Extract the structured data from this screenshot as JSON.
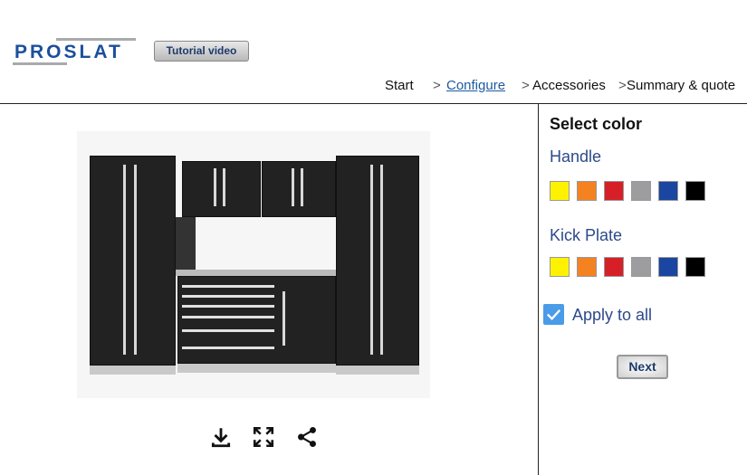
{
  "header": {
    "logo": "PROSLAT",
    "tutorial_label": "Tutorial video"
  },
  "nav": {
    "items": [
      "Start",
      "Configure",
      "Accessories",
      "Summary & quote"
    ],
    "separator": ">",
    "active": "Configure"
  },
  "panel": {
    "title": "Select color",
    "handle": {
      "label": "Handle",
      "colors": [
        "#fff200",
        "#f58220",
        "#d71f27",
        "#9d9d9f",
        "#1a45a0",
        "#000000"
      ]
    },
    "kick_plate": {
      "label": "Kick Plate",
      "colors": [
        "#fff200",
        "#f58220",
        "#d71f27",
        "#9d9d9f",
        "#1a45a0",
        "#000000"
      ]
    },
    "apply_all": {
      "label": "Apply to all",
      "checked": true
    },
    "next_label": "Next"
  },
  "toolbar": {
    "icons": [
      "download-icon",
      "fullscreen-icon",
      "share-icon"
    ]
  }
}
